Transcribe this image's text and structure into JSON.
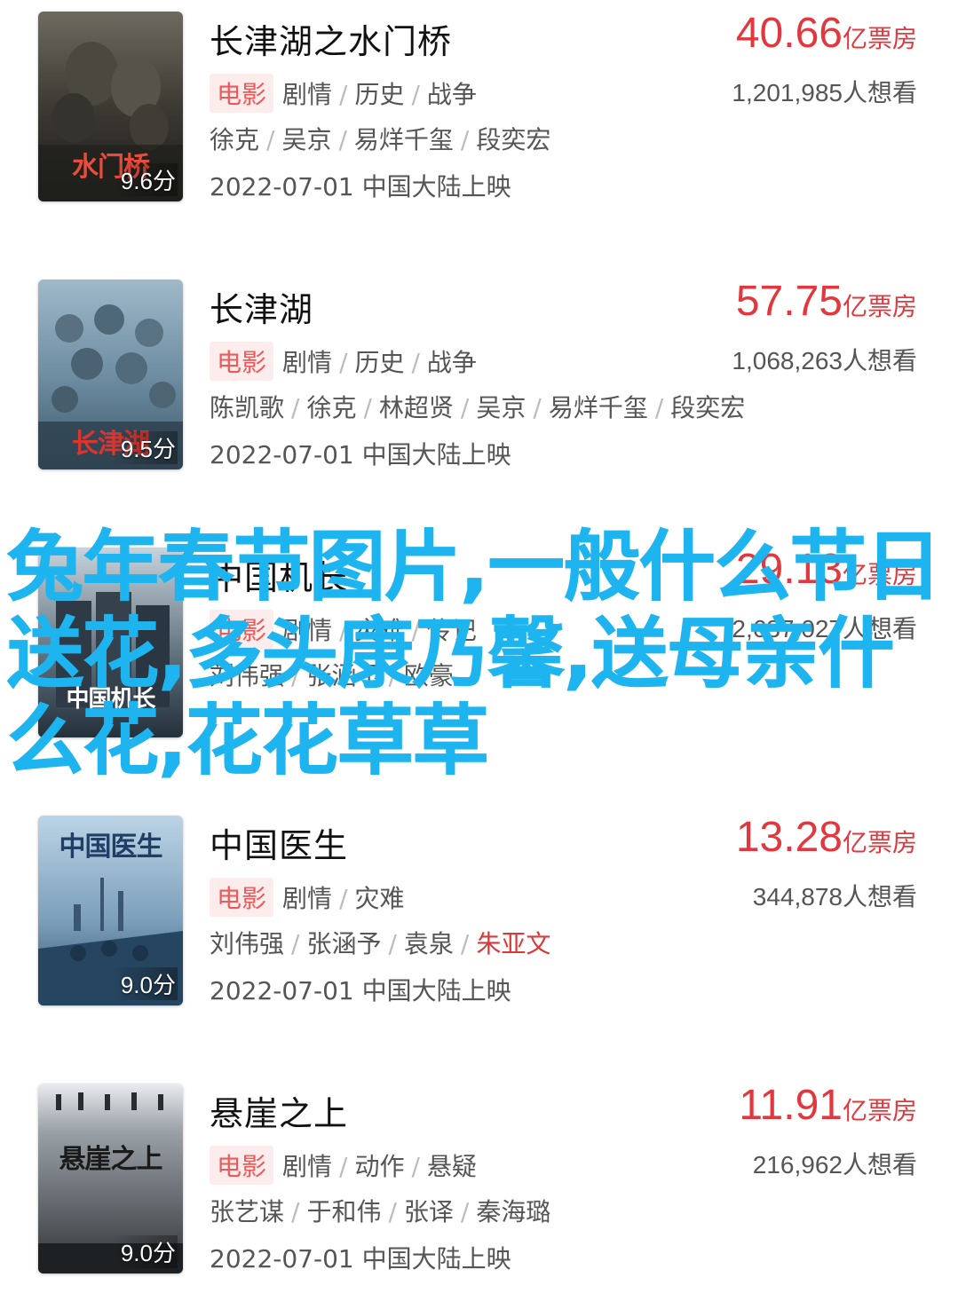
{
  "colors": {
    "box_office": "#e0383e",
    "tag_bg": "#fdecec",
    "tag_text": "#e95a5a",
    "overlay_text": "#1db4ef",
    "highlight_cast": "#d83a3a"
  },
  "movies": [
    {
      "title": "长津湖之水门桥",
      "box_office_value": "40.66",
      "box_office_unit": "亿票房",
      "tag": "电影",
      "genres": [
        "剧情",
        "历史",
        "战争"
      ],
      "want_count": "1,201,985",
      "want_label": "人想看",
      "cast": [
        "徐克",
        "吴京",
        "易烊千玺",
        "段奕宏"
      ],
      "release": "2022-07-01 中国大陆上映",
      "rating": "9.6分",
      "poster_text": "水门桥",
      "poster_icon": "war-poster-icon"
    },
    {
      "title": "长津湖",
      "box_office_value": "57.75",
      "box_office_unit": "亿票房",
      "tag": "电影",
      "genres": [
        "剧情",
        "历史",
        "战争"
      ],
      "want_count": "1,068,263",
      "want_label": "人想看",
      "cast": [
        "陈凯歌",
        "徐克",
        "林超贤",
        "吴京",
        "易烊千玺",
        "段奕宏"
      ],
      "release": "2022-07-01 中国大陆上映",
      "rating": "9.5分",
      "poster_text": "长津湖",
      "poster_icon": "soldiers-poster-icon"
    },
    {
      "title": "中国机长",
      "box_office_value": "29.13",
      "box_office_unit": "亿票房",
      "tag": "电影",
      "genres": [
        "剧情",
        "灾难",
        "传记"
      ],
      "want_count": "2,637,027",
      "want_label": "人想看",
      "cast": [
        "刘伟强",
        "张涵予",
        "欧豪"
      ],
      "release": "",
      "rating": "",
      "poster_text": "中国机长",
      "poster_icon": "pilot-poster-icon"
    },
    {
      "title": "中国医生",
      "box_office_value": "13.28",
      "box_office_unit": "亿票房",
      "tag": "电影",
      "genres": [
        "剧情",
        "灾难"
      ],
      "want_count": "344,878",
      "want_label": "人想看",
      "cast": [
        "刘伟强",
        "张涵予",
        "袁泉",
        "朱亚文"
      ],
      "release": "2022-07-01 中国大陆上映",
      "rating": "9.0分",
      "poster_text": "中国医生",
      "poster_icon": "doctor-poster-icon"
    },
    {
      "title": "悬崖之上",
      "box_office_value": "11.91",
      "box_office_unit": "亿票房",
      "tag": "电影",
      "genres": [
        "剧情",
        "动作",
        "悬疑"
      ],
      "want_count": "216,962",
      "want_label": "人想看",
      "cast": [
        "张艺谋",
        "于和伟",
        "张译",
        "秦海璐"
      ],
      "release": "2022-07-01 中国大陆上映",
      "rating": "9.0分",
      "poster_text": "悬崖之上",
      "poster_icon": "snow-poster-icon"
    }
  ],
  "overlay_text": "兔年春节图片,一般什么节日送花,多头康乃馨,送母亲什么花,花花草草"
}
